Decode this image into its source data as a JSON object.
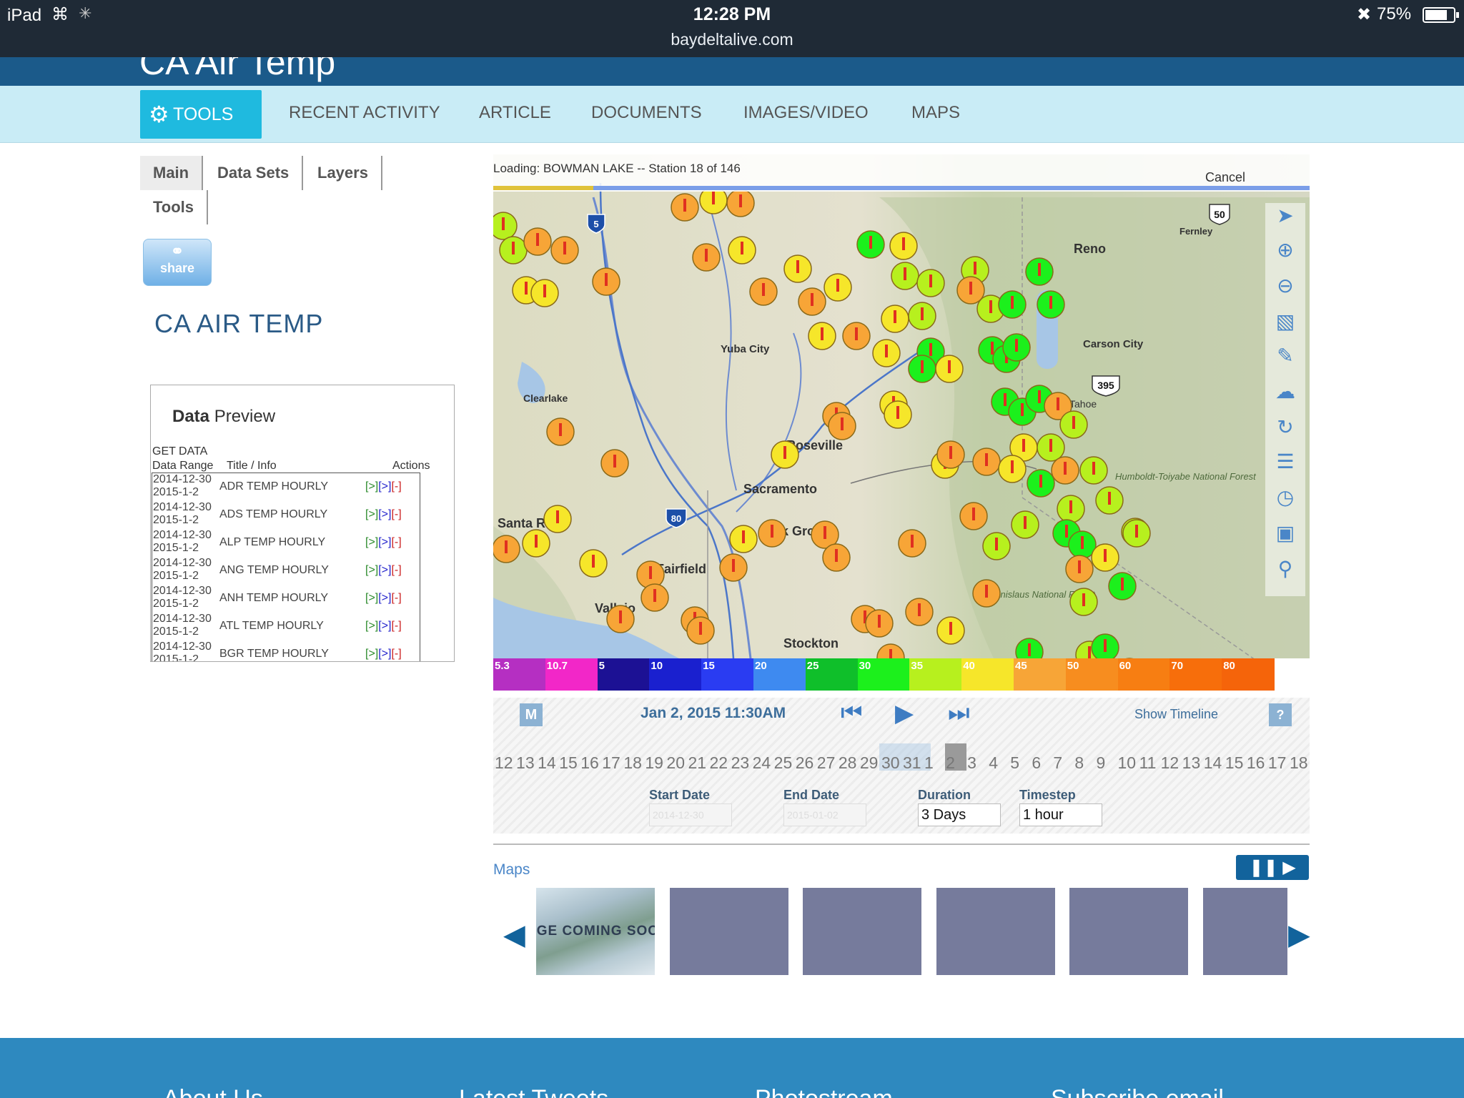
{
  "status_bar": {
    "device": "iPad",
    "wifi_icon": "wifi-icon",
    "time": "12:28 PM",
    "url": "baydeltalive.com",
    "bluetooth_icon": "bluetooth-icon",
    "battery": "75%"
  },
  "site": {
    "banner_title": "CA Air Temp",
    "nav": {
      "tools": "TOOLS",
      "items": [
        "RECENT ACTIVITY",
        "ARTICLE",
        "DOCUMENTS",
        "IMAGES/VIDEO",
        "MAPS"
      ]
    }
  },
  "panel": {
    "tabs": [
      "Main",
      "Data Sets",
      "Layers",
      "Tools"
    ],
    "share": "share",
    "heading": "CA AIR TEMP",
    "preview": {
      "title_bold": "Data",
      "title_rest": " Preview",
      "get_data": "GET DATA",
      "col_range": "Data Range",
      "col_title": "Title / Info",
      "col_actions": "Actions",
      "rows": [
        {
          "start": "2014-12-30",
          "end": "2015-1-2",
          "title": "ADR TEMP HOURLY"
        },
        {
          "start": "2014-12-30",
          "end": "2015-1-2",
          "title": "ADS TEMP HOURLY"
        },
        {
          "start": "2014-12-30",
          "end": "2015-1-2",
          "title": "ALP TEMP HOURLY"
        },
        {
          "start": "2014-12-30",
          "end": "2015-1-2",
          "title": "ANG TEMP HOURLY"
        },
        {
          "start": "2014-12-30",
          "end": "2015-1-2",
          "title": "ANH TEMP HOURLY"
        },
        {
          "start": "2014-12-30",
          "end": "2015-1-2",
          "title": "ATL TEMP HOURLY"
        },
        {
          "start": "2014-12-30",
          "end": "2015-1-2",
          "title": "BGR TEMP HOURLY"
        }
      ],
      "action_g": "[>]",
      "action_b": "[>]",
      "action_r": "[-]"
    }
  },
  "map": {
    "loading": "Loading: BOWMAN LAKE -- Station 18 of 146",
    "loading_progress": 0.123,
    "cancel": "Cancel",
    "labels": [
      "Reno",
      "Fernley",
      "Carson City",
      "Yuba City",
      "Clearlake",
      "Roseville",
      "Sacramento",
      "Elk Grove",
      "Fairfield",
      "Vallejo",
      "Stockton",
      "Santa Rosa",
      "Lake Tahoe",
      "Humboldt-Toiyabe National Forest",
      "Stanislaus National Forest"
    ],
    "shields": [
      "5",
      "80",
      "50",
      "395"
    ],
    "tools": [
      "pointer-icon",
      "zoom-in-icon",
      "zoom-out-icon",
      "ruler-icon",
      "pencil-icon",
      "cloud-upload-icon",
      "refresh-icon",
      "layers-icon",
      "clock-icon",
      "fullscreen-icon",
      "search-icon"
    ]
  },
  "legend": {
    "segments": [
      {
        "label": "5.3",
        "color": "#b52fc2"
      },
      {
        "label": "10.7",
        "color": "#f227c8"
      },
      {
        "label": "5",
        "color": "#1c1194"
      },
      {
        "label": "10",
        "color": "#1a20cf"
      },
      {
        "label": "15",
        "color": "#2a3cf2"
      },
      {
        "label": "20",
        "color": "#3e8af0"
      },
      {
        "label": "25",
        "color": "#0fbf2a"
      },
      {
        "label": "30",
        "color": "#1cf01c"
      },
      {
        "label": "35",
        "color": "#b7f01e"
      },
      {
        "label": "40",
        "color": "#f6e62a"
      },
      {
        "label": "45",
        "color": "#f7a537"
      },
      {
        "label": "50",
        "color": "#f78d1f"
      },
      {
        "label": "60",
        "color": "#f77e12"
      },
      {
        "label": "70",
        "color": "#f76e0b"
      },
      {
        "label": "80",
        "color": "#f5640a"
      }
    ]
  },
  "timeline": {
    "m_button": "M",
    "current": "Jan 2, 2015 11:30AM",
    "show_timeline": "Show Timeline",
    "help": "?",
    "ticks": [
      "12",
      "13",
      "14",
      "15",
      "16",
      "17",
      "18",
      "19",
      "20",
      "21",
      "22",
      "23",
      "24",
      "25",
      "26",
      "27",
      "28",
      "29",
      "30",
      "31",
      "1",
      "2",
      "3",
      "4",
      "5",
      "6",
      "7",
      "8",
      "9",
      "10",
      "11",
      "12",
      "13",
      "14",
      "15",
      "16",
      "17",
      "18"
    ],
    "start_label": "Start Date",
    "start_value": "2014-12-30",
    "end_label": "End Date",
    "end_value": "2015-01-02",
    "duration_label": "Duration",
    "duration_value": "3 Days",
    "timestep_label": "Timestep",
    "timestep_value": "1 hour"
  },
  "carousel": {
    "label": "Maps",
    "first_thumb": "AGE COMING SOON",
    "thumbs": 6
  },
  "footer": {
    "headings": [
      "About Us",
      "Latest Tweets",
      "Photostream",
      "Subscribe email"
    ]
  }
}
